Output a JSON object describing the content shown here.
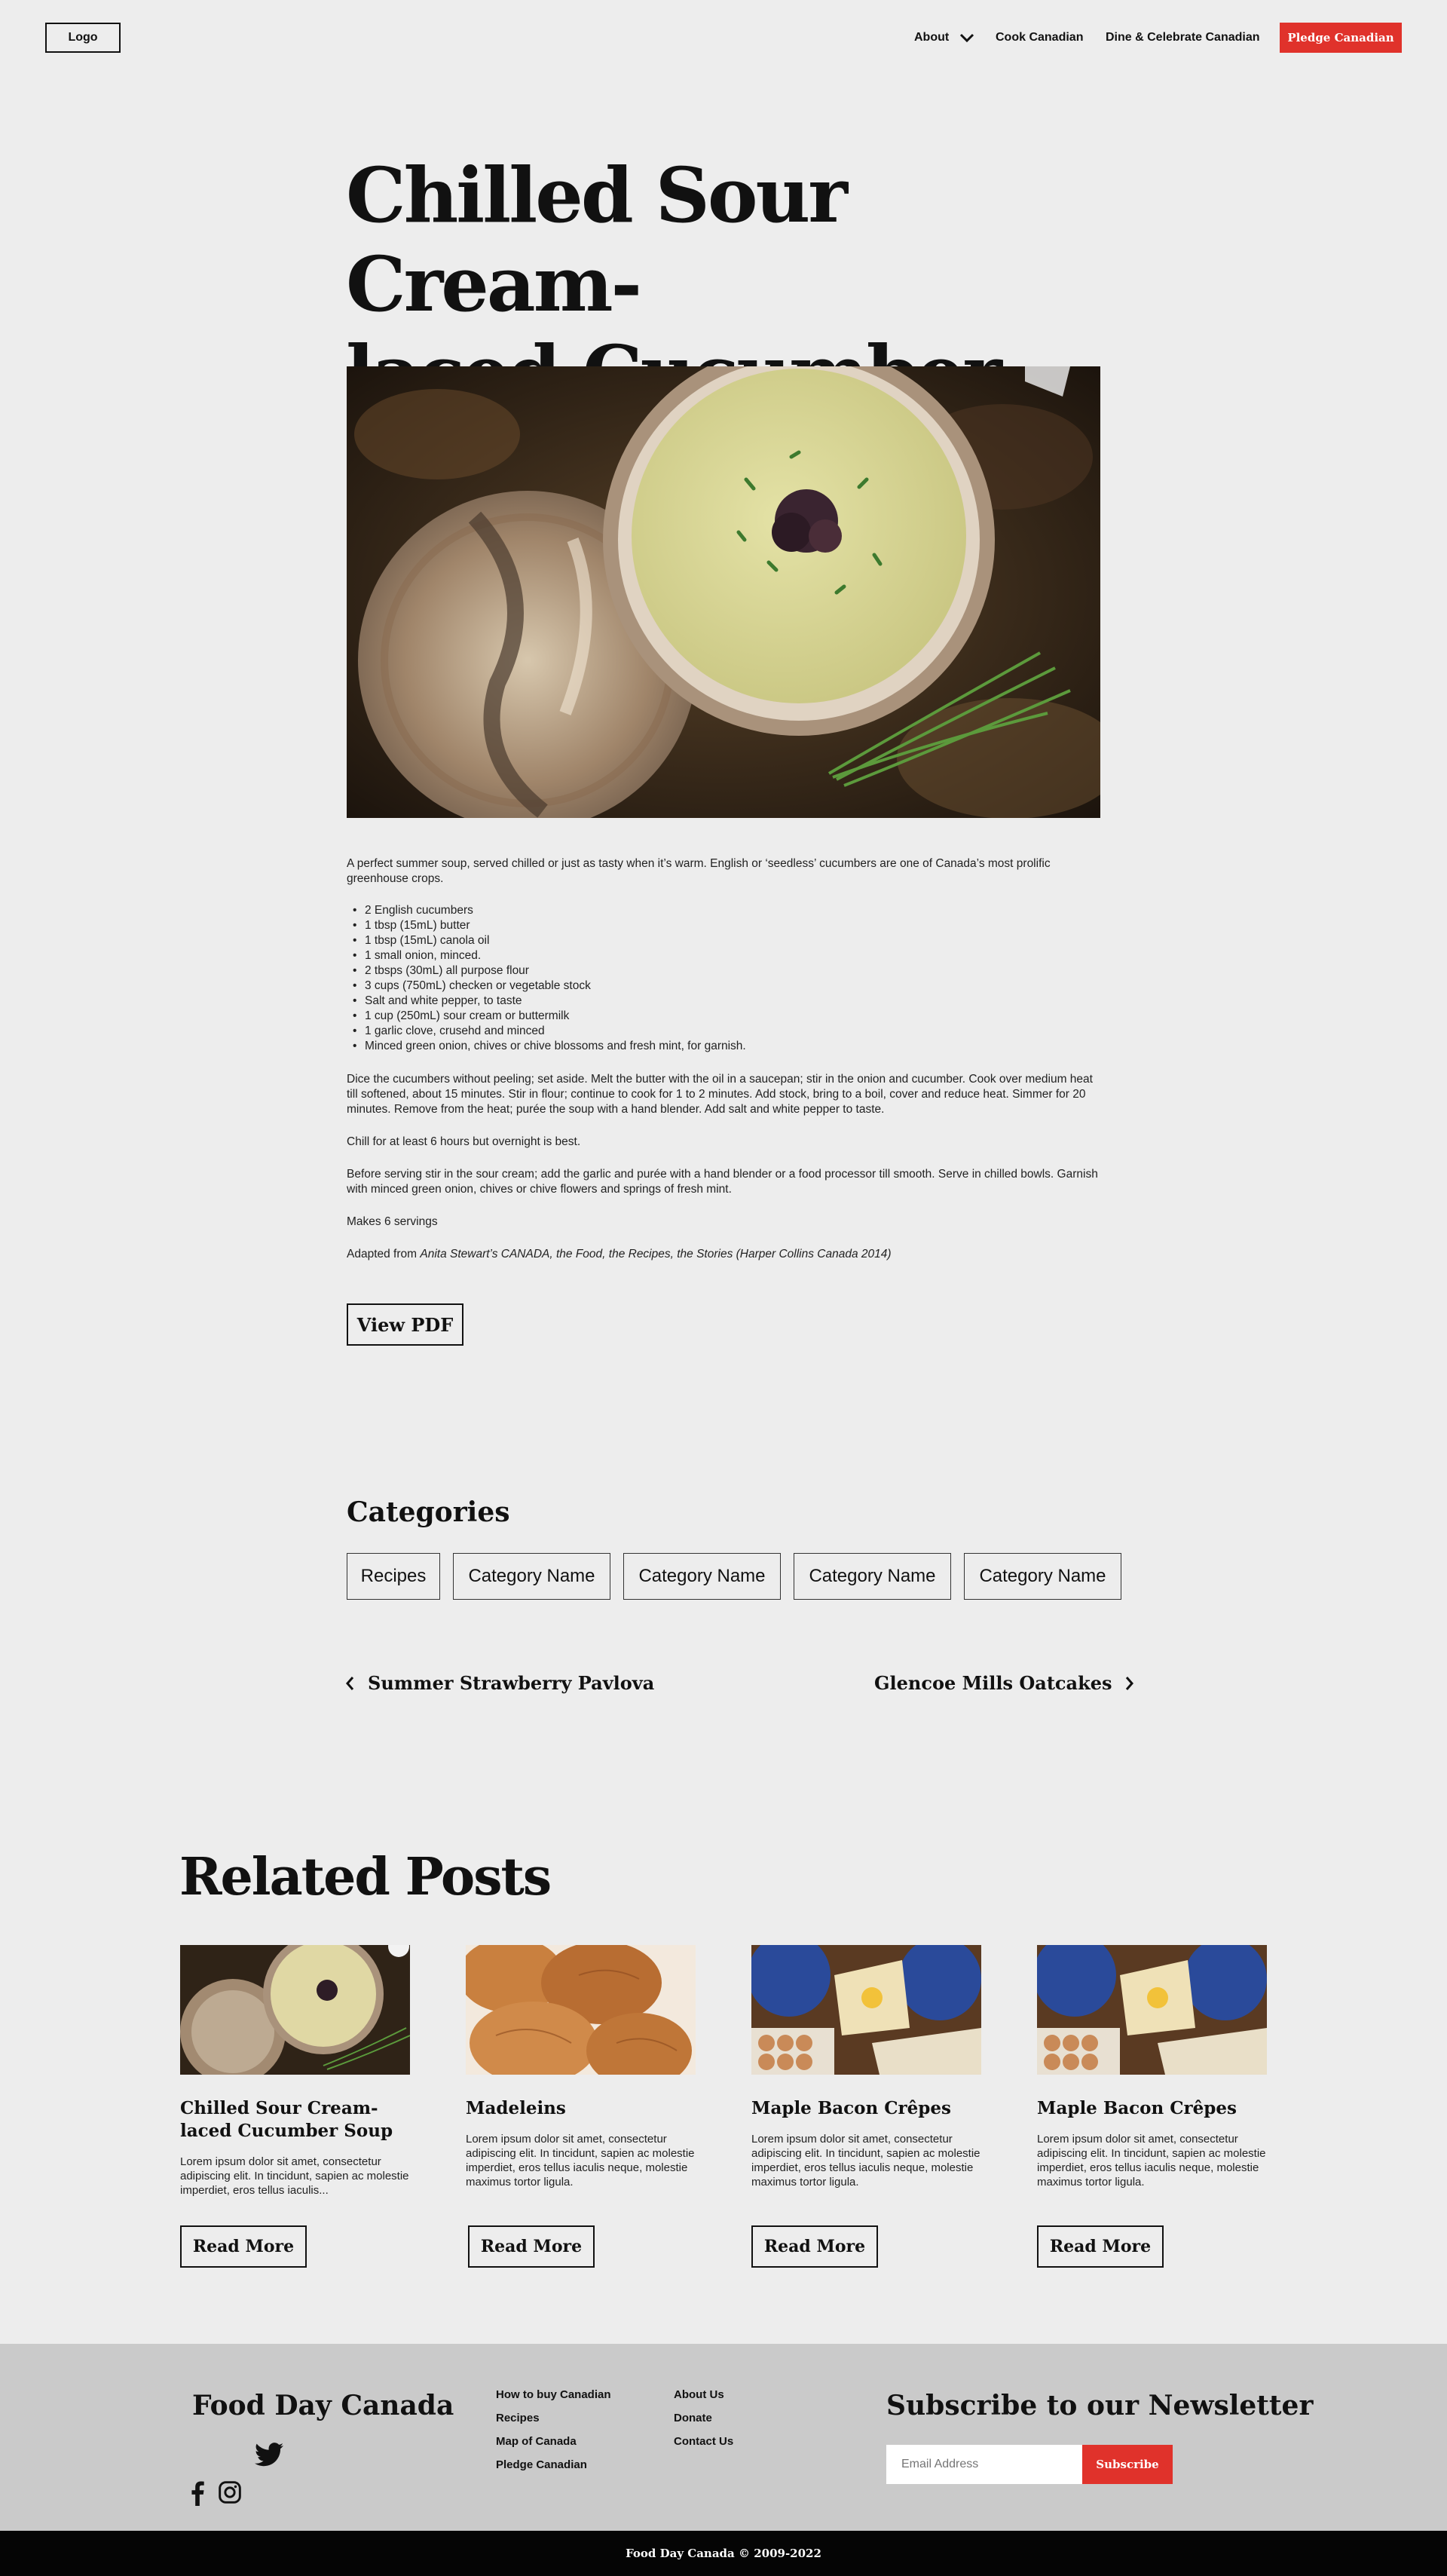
{
  "header": {
    "logo": "Logo",
    "nav": {
      "about": "About",
      "cook": "Cook Canadian",
      "dine": "Dine & Celebrate Canadian"
    },
    "pledge_button": "Pledge Canadian"
  },
  "article": {
    "title_line1": "Chilled Sour Cream-",
    "title_line2": "laced Cucumber Soup",
    "intro": "A perfect summer soup, served chilled or just as tasty when it’s warm. English or ‘seedless’ cucumbers are one of Canada’s most prolific greenhouse crops.",
    "ingredients": [
      "2 English cucumbers",
      "1 tbsp (15mL) butter",
      "1 tbsp (15mL) canola oil",
      "1 small onion, minced.",
      "2 tbsps (30mL) all purpose flour",
      "3 cups (750mL) checken or vegetable stock",
      "Salt and white pepper, to taste",
      "1 cup (250mL) sour cream or buttermilk",
      "1 garlic clove, crusehd and minced",
      "Minced green onion, chives or chive blossoms and fresh mint, for garnish."
    ],
    "step1": "Dice the cucumbers without peeling; set aside. Melt the butter with the oil in a saucepan; stir in the onion and cucumber. Cook over medium heat till softened, about 15 minutes. Stir in flour; continue to cook for 1 to 2 minutes. Add stock, bring to a boil, cover and reduce heat. Simmer for 20 minutes. Remove from the heat; purée the soup with a hand blender. Add salt and white pepper to taste.",
    "step2": "Chill for at least 6 hours but overnight is best.",
    "step3": "Before serving stir in the sour cream; add the garlic and purée with a hand blender or a food processor till smooth. Serve in chilled bowls. Garnish with minced green onion, chives or chive flowers and springs of fresh mint.",
    "servings": "Makes 6 servings",
    "adapted_prefix": "Adapted from ",
    "adapted_source": "Anita Stewart’s CANADA, the Food, the Recipes, the Stories (Harper Collins Canada 2014)",
    "pdf_button": "View PDF"
  },
  "categories": {
    "title": "Categories",
    "items": [
      "Recipes",
      "Category Name",
      "Category Name",
      "Category Name",
      "Category Name"
    ]
  },
  "pagination": {
    "prev": "Summer Strawberry Pavlova",
    "next": "Glencoe Mills Oatcakes"
  },
  "related": {
    "title": "Related Posts",
    "posts": [
      {
        "title": "Chilled Sour Cream-laced Cucumber Soup",
        "excerpt": "Lorem ipsum dolor sit amet, consectetur adipiscing elit. In tincidunt, sapien ac molestie imperdiet, eros tellus iaculis...",
        "button": "Read More"
      },
      {
        "title": "Madeleins",
        "excerpt": "Lorem ipsum dolor sit amet, consectetur adipiscing elit. In tincidunt, sapien ac molestie imperdiet, eros tellus iaculis neque, molestie maximus tortor ligula.",
        "button": "Read More"
      },
      {
        "title": "Maple Bacon Crêpes",
        "excerpt": "Lorem ipsum dolor sit amet, consectetur adipiscing elit. In tincidunt, sapien ac molestie imperdiet, eros tellus iaculis neque, molestie maximus tortor ligula.",
        "button": "Read More"
      },
      {
        "title": "Maple Bacon Crêpes",
        "excerpt": "Lorem ipsum dolor sit amet, consectetur adipiscing elit. In tincidunt, sapien ac molestie imperdiet, eros tellus iaculis neque, molestie maximus tortor ligula.",
        "button": "Read More"
      }
    ]
  },
  "footer": {
    "brand": "Food Day Canada",
    "col1": [
      "How to buy Canadian",
      "Recipes",
      "Map of Canada",
      "Pledge Canadian"
    ],
    "col2": [
      "About Us",
      "Donate",
      "Contact Us"
    ],
    "newsletter_title": "Subscribe to our Newsletter",
    "email_placeholder": "Email Address",
    "subscribe_button": "Subscribe",
    "copyright": "Food Day Canada © 2009-2022"
  },
  "colors": {
    "accent": "#e0322b",
    "background": "#ededed",
    "footer": "#cacaca",
    "bottom_bar": "#050505"
  }
}
